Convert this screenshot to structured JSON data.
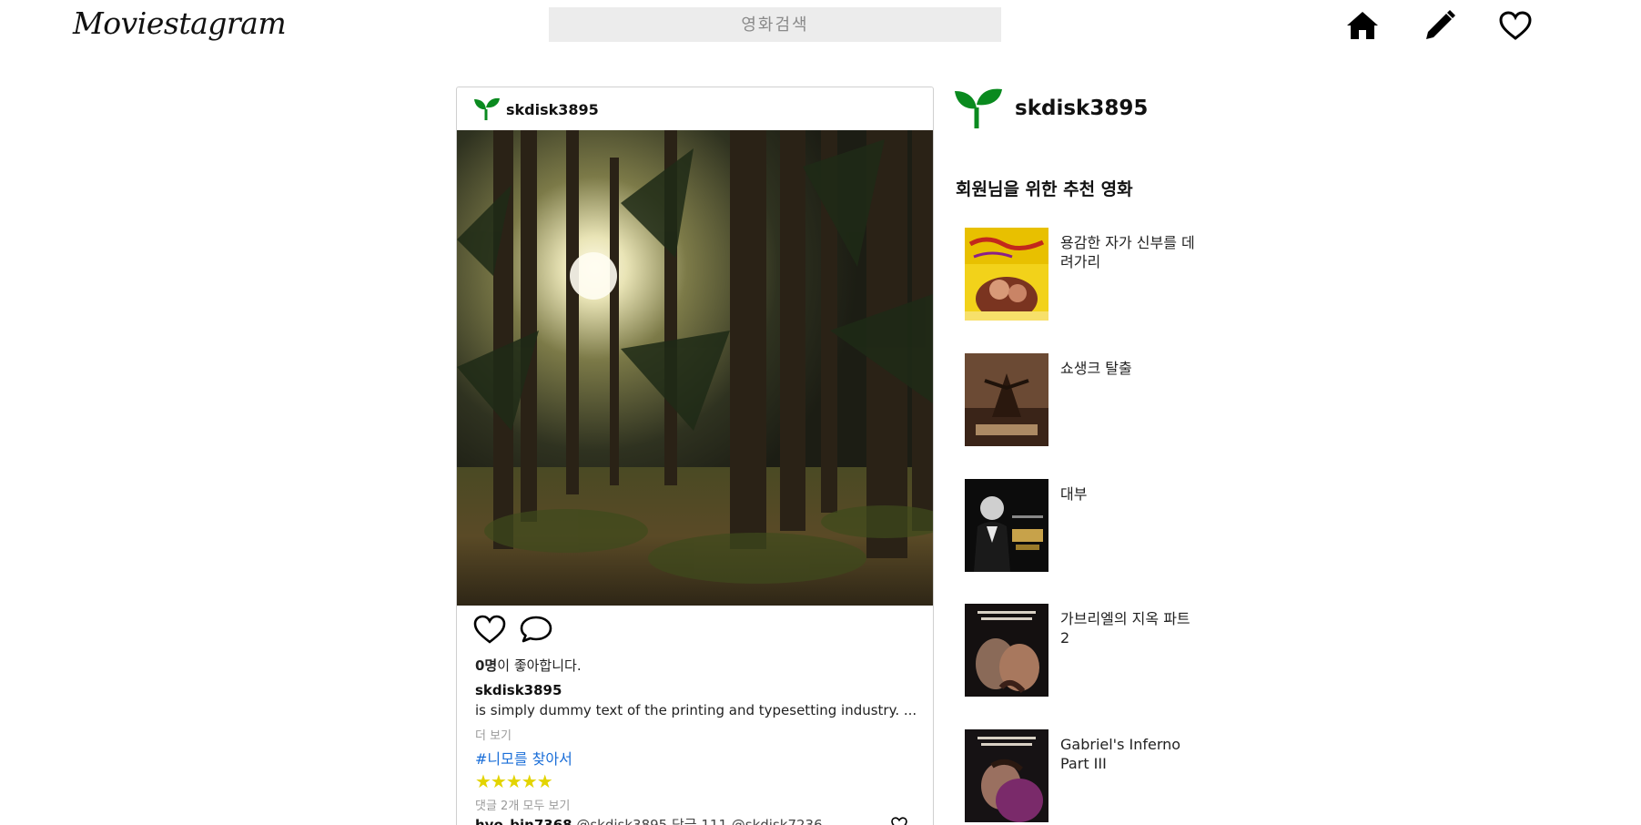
{
  "header": {
    "logo": "Moviestagram",
    "search_placeholder": "영화검색",
    "icons": [
      "home-icon",
      "pencil-icon",
      "heart-icon"
    ]
  },
  "post": {
    "username": "skdisk3895",
    "likes_count": "0명",
    "likes_suffix": "이 좋아합니다.",
    "caption_user": "skdisk3895",
    "caption": "is simply dummy text of the printing and typesetting industry. ...",
    "more_label": "더 보기",
    "hashtag": "#니모를 찾아서",
    "stars": "★★★★★",
    "rating": 5,
    "view_all_comments": "댓글 2개 모두 보기",
    "comment": {
      "user": "hyo_bin7368",
      "text": "@skdisk3895 답글 111 @skdisk7236"
    }
  },
  "sidebar": {
    "username": "skdisk3895",
    "recommend_title": "회원님을 위한 추천 영화",
    "movies": [
      {
        "title": "용감한 자가 신부를 데려가리"
      },
      {
        "title": "쇼생크 탈출"
      },
      {
        "title": "대부"
      },
      {
        "title": "가브리엘의 지옥 파트 2"
      },
      {
        "title": "Gabriel's Inferno Part III"
      }
    ]
  },
  "colors": {
    "accent_green": "#0a8a1f",
    "hashtag_blue": "#1a6ed8",
    "star_yellow": "#e3d400",
    "search_bg": "#ececec"
  }
}
